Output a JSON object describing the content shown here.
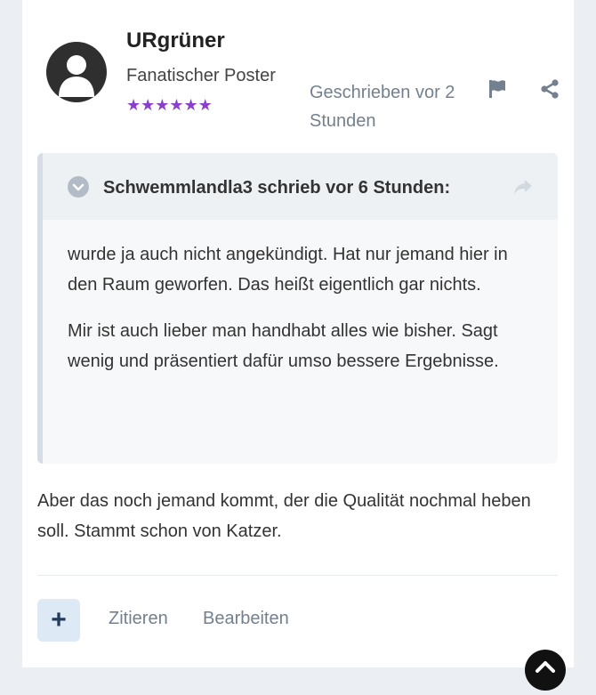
{
  "post": {
    "author": {
      "name": "URgrüner",
      "title": "Fanatischer Poster",
      "rank_stars": "★★★★★★"
    },
    "timestamp": "Geschrieben vor 2 Stunden",
    "quote": {
      "header": "Schwemmlandla3 schrieb vor 6 Stunden:",
      "paragraphs": [
        "wurde ja auch nicht angekündigt. Hat nur jemand hier in den Raum geworfen. Das heißt eigentlich gar nichts.",
        "Mir ist auch lieber man handhabt alles wie bisher. Sagt wenig und präsentiert dafür umso bessere Ergebnisse."
      ]
    },
    "body": "Aber das noch jemand kommt, der die Qualität nochmal heben soll. Stammt schon von Katzer."
  },
  "actions": {
    "react_label": "+",
    "quote_label": "Zitieren",
    "edit_label": "Bearbeiten"
  },
  "icons": {
    "avatar": "user-avatar-placeholder",
    "flag": "flag-icon",
    "share": "share-icon",
    "quote_toggle": "chevron-down-icon",
    "quote_goto": "share-arrow-icon",
    "scroll_top": "chevron-up-icon"
  },
  "colors": {
    "rank_stars": "#8b3fd1",
    "muted_text": "#73808f",
    "react_button_bg": "#dde9f5"
  }
}
